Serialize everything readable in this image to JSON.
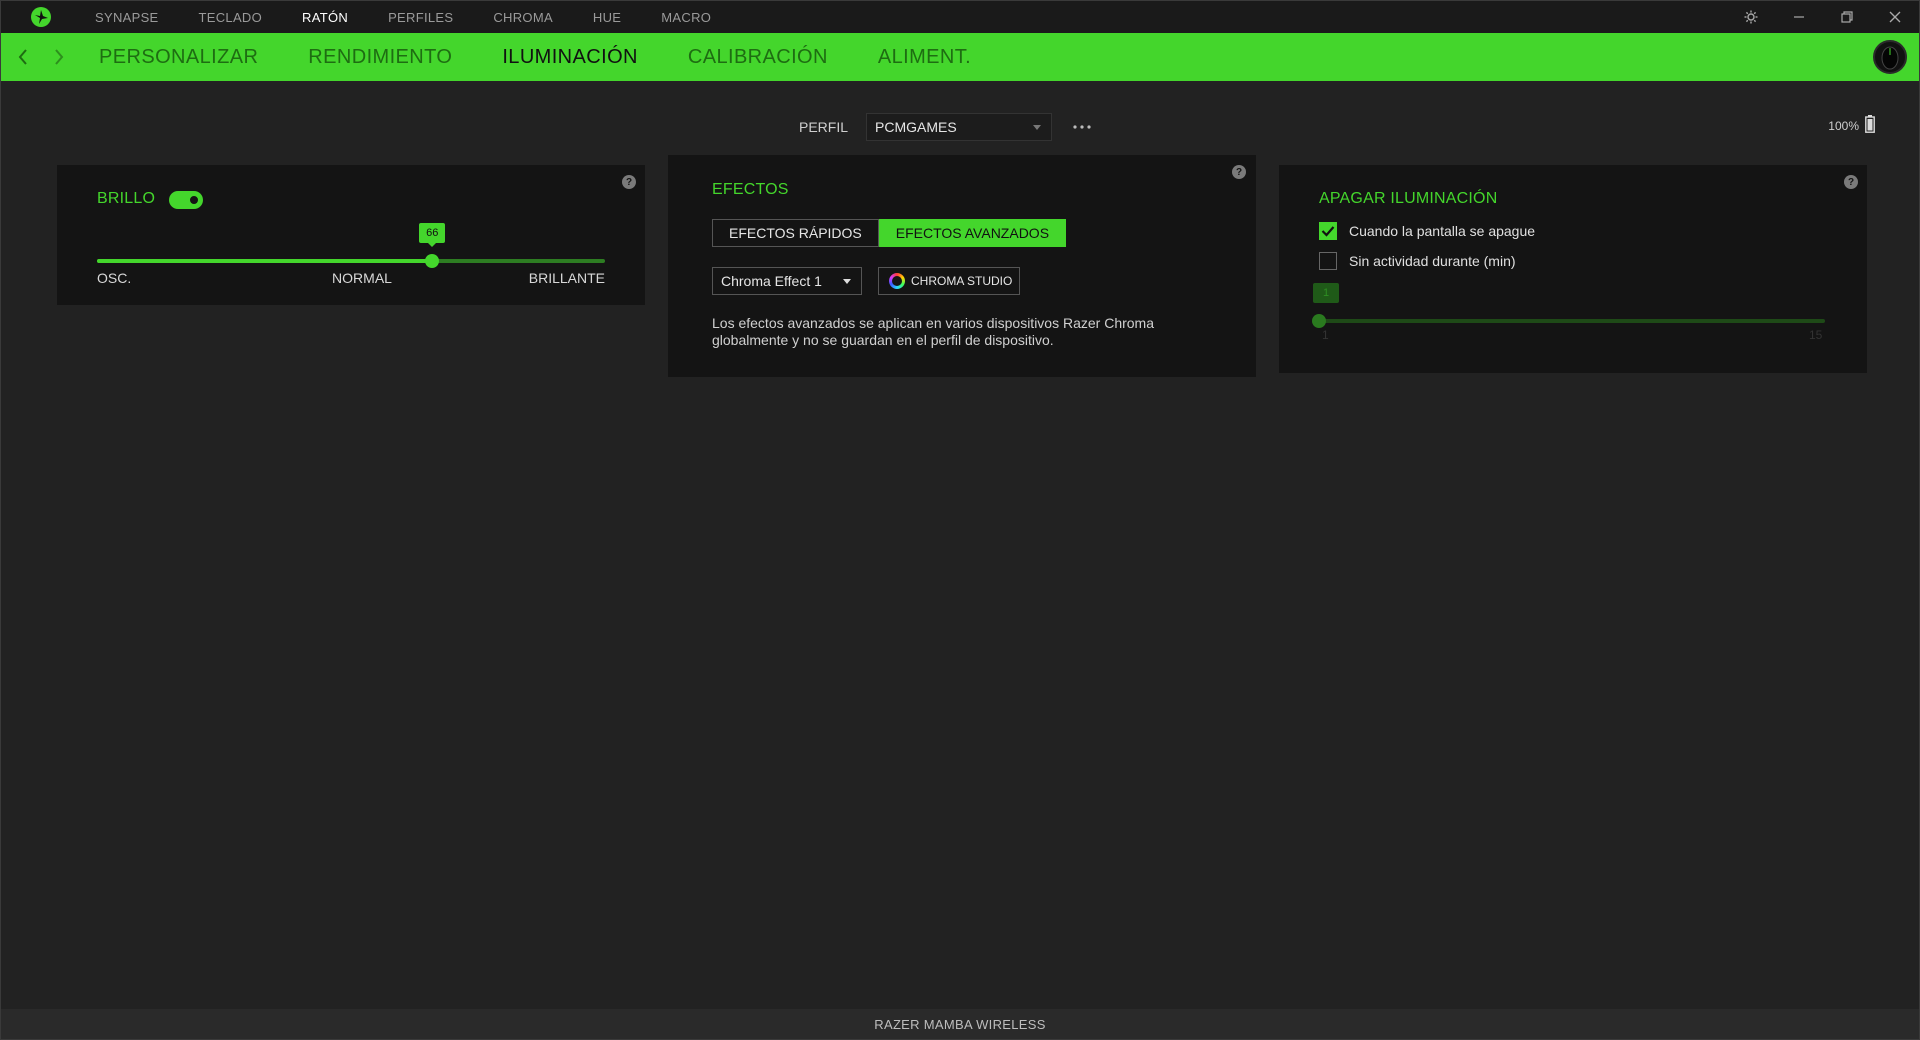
{
  "topnav": {
    "items": [
      {
        "label": "SYNAPSE"
      },
      {
        "label": "TECLADO"
      },
      {
        "label": "RATÓN"
      },
      {
        "label": "PERFILES"
      },
      {
        "label": "CHROMA"
      },
      {
        "label": "HUE"
      },
      {
        "label": "MACRO"
      }
    ],
    "active_index": 2
  },
  "subnav": {
    "tabs": [
      {
        "label": "PERSONALIZAR"
      },
      {
        "label": "RENDIMIENTO"
      },
      {
        "label": "ILUMINACIÓN"
      },
      {
        "label": "CALIBRACIÓN"
      },
      {
        "label": "ALIMENT."
      }
    ],
    "active_index": 2
  },
  "profile": {
    "label": "PERFIL",
    "selected": "PCMGAMES"
  },
  "battery": {
    "percent_text": "100%"
  },
  "brightness": {
    "title": "BRILLO",
    "enabled": true,
    "value": 66,
    "value_text": "66",
    "min": 0,
    "max": 100,
    "label_low": "OSC.",
    "label_mid": "NORMAL",
    "label_high": "BRILLANTE"
  },
  "effects": {
    "title": "EFECTOS",
    "tabs": [
      {
        "label": "EFECTOS RÁPIDOS"
      },
      {
        "label": "EFECTOS AVANZADOS"
      }
    ],
    "active_tab": 1,
    "selected_effect": "Chroma Effect 1",
    "studio_label": "CHROMA STUDIO",
    "description": "Los efectos avanzados se aplican en varios dispositivos Razer Chroma globalmente y no se guardan en el perfil de dispositivo."
  },
  "lights_off": {
    "title": "APAGAR ILUMINACIÓN",
    "option_screen_off": {
      "label": "Cuando la pantalla se apague",
      "checked": true
    },
    "option_idle": {
      "label": "Sin actividad durante (min)",
      "checked": false
    },
    "idle_value": 1,
    "idle_value_text": "1",
    "idle_min": 1,
    "idle_max": 15,
    "idle_min_text": "1",
    "idle_max_text": "15"
  },
  "footer": {
    "device_name": "RAZER MAMBA WIRELESS"
  },
  "colors": {
    "accent": "#44d62c",
    "background": "#222222",
    "panel": "#141414"
  }
}
